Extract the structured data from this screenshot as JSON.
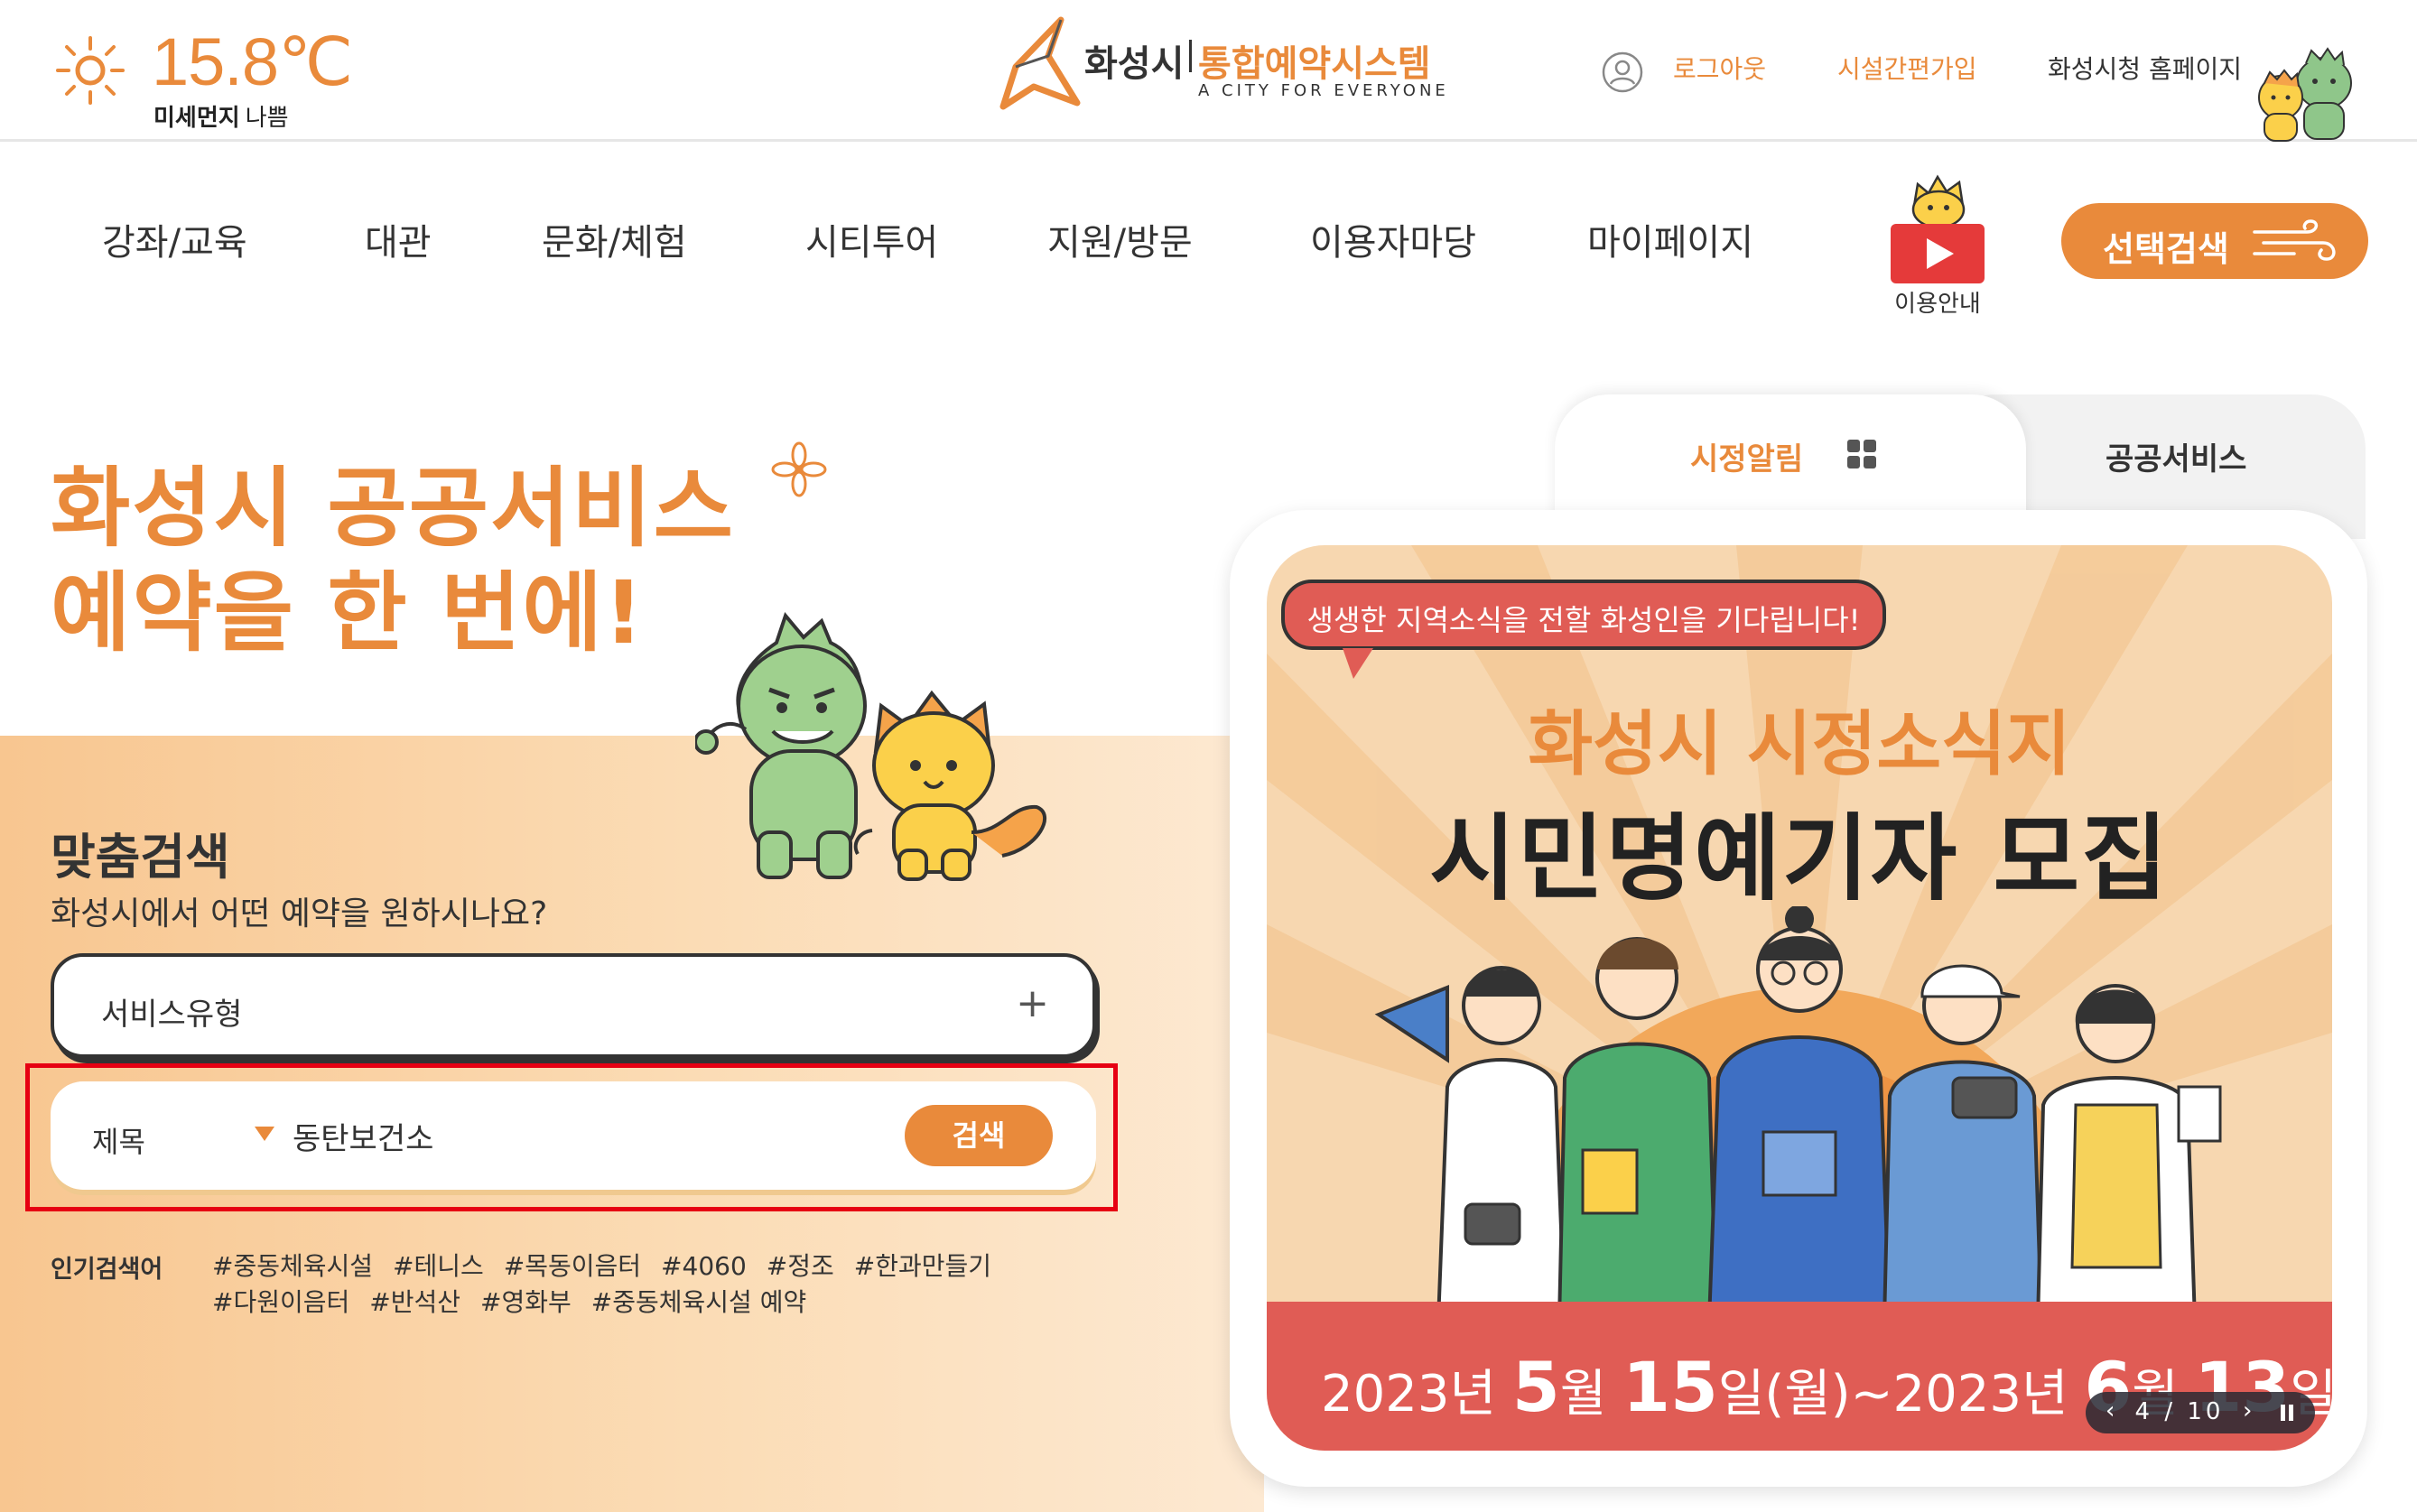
{
  "weather": {
    "temperature": "15.8℃",
    "dust_label": "미세먼지",
    "dust_state": "나쁨"
  },
  "logo": {
    "city": "화성시",
    "system": "통합예약시스템",
    "tagline": "A CITY FOR EVERYONE"
  },
  "top_links": {
    "logout": "로그아웃",
    "easy_join": "시설간편가입",
    "homepage": "화성시청 홈페이지"
  },
  "menu": [
    "강좌/교육",
    "대관",
    "문화/체험",
    "시티투어",
    "지원/방문",
    "이용자마당",
    "마이페이지"
  ],
  "guide_label": "이용안내",
  "select_search_label": "선택검색",
  "hero": {
    "line1": "화성시 공공서비스",
    "line2": "예약을 한 번에!"
  },
  "custom_search": {
    "title": "맞춤검색",
    "subtitle": "화성시에서 어떤 예약을 원하시나요?",
    "service_type": "서비스유형",
    "service_toggle": "+",
    "field_select": "제목",
    "query": "동탄보건소",
    "search_button": "검색"
  },
  "popular": {
    "label": "인기검색어",
    "row1": [
      "#중동체육시설",
      "#테니스",
      "#목동이음터",
      "#4060",
      "#정조",
      "#한과만들기"
    ],
    "row2": [
      "#다원이음터",
      "#반석산",
      "#영화부",
      "#중동체육시설 예약"
    ]
  },
  "tabs": {
    "active": "시정알림",
    "inactive": "공공서비스"
  },
  "banner": {
    "bubble": "생생한 지역소식을 전할 화성인을 기다립니다!",
    "headline1": "화성시 시정소식지",
    "headline2": "시민명예기자 모집",
    "date_pre1": "2023년 ",
    "date_m1": "5",
    "date_mid1": "월 ",
    "date_d1": "15",
    "date_post1": "일(월)~2023년 ",
    "date_m2": "6",
    "date_mid2": "월 ",
    "date_d2": "13",
    "date_post2": "일(화)"
  },
  "pager": {
    "current": "4",
    "total": "10",
    "display": "4 / 10"
  },
  "colors": {
    "accent": "#e98a3b",
    "highlight": "#e60012",
    "banner_red": "#e05c55"
  }
}
